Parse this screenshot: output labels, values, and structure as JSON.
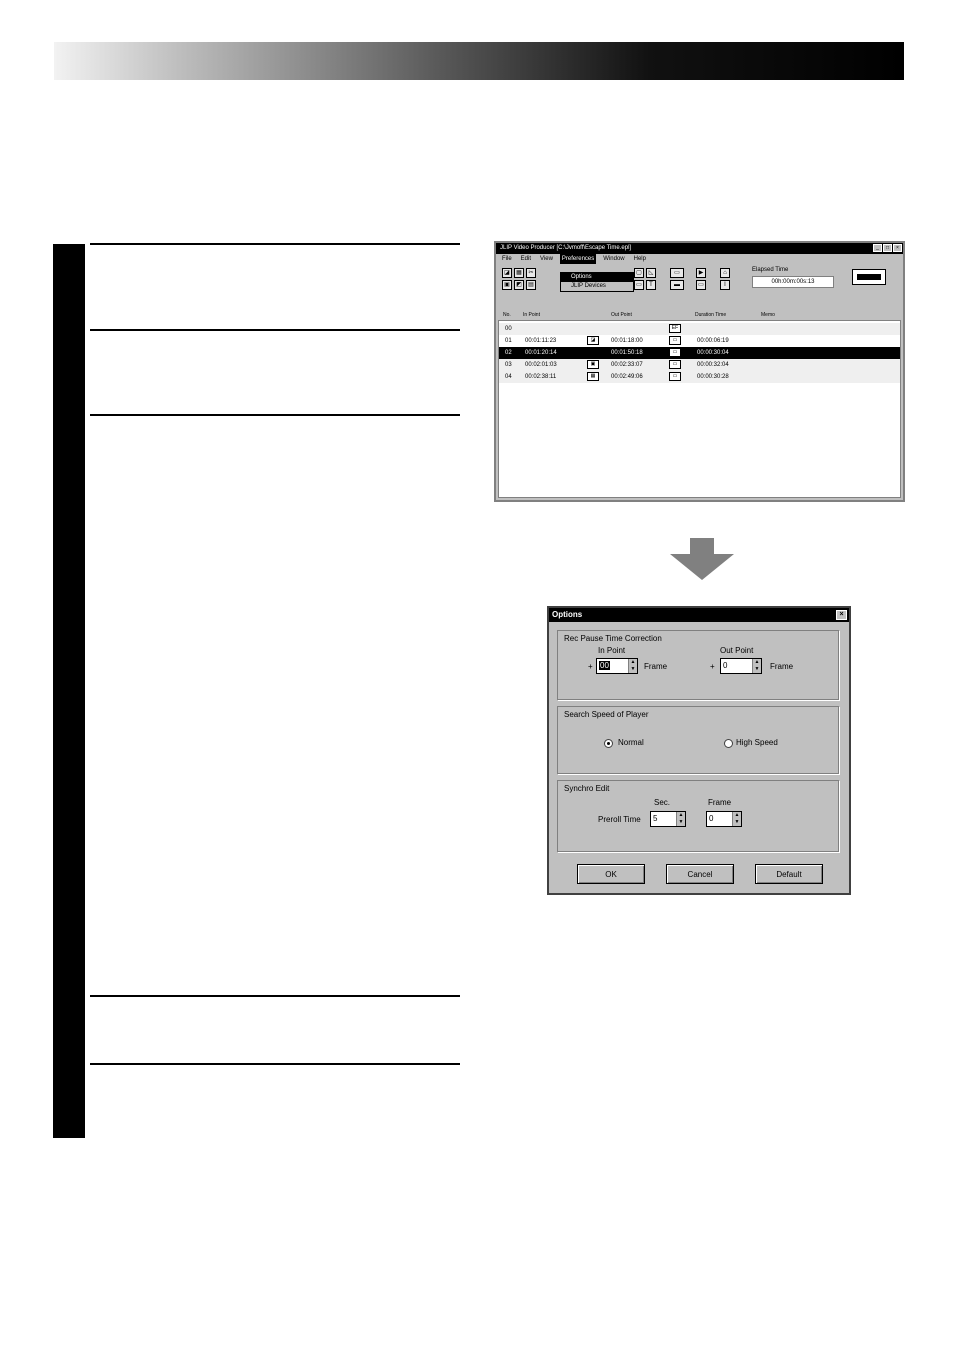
{
  "app_window": {
    "title": "JLIP Video Producer [C:\\Jvmoff\\Escape Time.epl]",
    "title_buttons": [
      "_",
      "□",
      "×"
    ],
    "menu": [
      "File",
      "Edit",
      "View",
      "Preferences",
      "Window",
      "Help"
    ],
    "active_menu_index": 3,
    "dropdown_items": [
      "Options",
      "JLIP Devices"
    ],
    "elapsed_label": "Elapsed Time",
    "elapsed_value": "00h:00m:00s:13",
    "columns": [
      "No.",
      "In Point",
      "Out Point",
      "Duration Time",
      "Memo"
    ],
    "rows": [
      {
        "no": "00",
        "in": "",
        "out": "",
        "icon_out": "EF",
        "duration": ""
      },
      {
        "no": "01",
        "in": "00:01:11:23",
        "out": "00:01:18:00",
        "icon_in": "◪",
        "icon_out": "▭",
        "duration": "00:00:06:19"
      },
      {
        "no": "02",
        "in": "00:01:20:14",
        "out": "00:01:50:18",
        "icon_in": "",
        "icon_out": "▭",
        "duration": "00:00:30:04",
        "selected": true
      },
      {
        "no": "03",
        "in": "00:02:01:03",
        "out": "00:02:33:07",
        "icon_in": "▣",
        "icon_out": "▭",
        "duration": "00:00:32:04"
      },
      {
        "no": "04",
        "in": "00:02:38:11",
        "out": "00:02:49:06",
        "icon_in": "▦",
        "icon_out": "▭",
        "duration": "00:00:30:28"
      }
    ]
  },
  "dialog": {
    "title": "Options",
    "close_glyph": "×",
    "group1_title": "Rec Pause Time Correction",
    "in_point_label": "In Point",
    "out_point_label": "Out Point",
    "sign_in": "+",
    "sign_out": "+",
    "in_value": "00",
    "out_value": "0",
    "frame_unit": "Frame",
    "group2_title": "Search Speed of Player",
    "normal_label": "Normal",
    "high_speed_label": "High Speed",
    "search_speed_selected": "Normal",
    "group3_title": "Synchro Edit",
    "sec_label": "Sec.",
    "frame_label": "Frame",
    "preroll_label": "Preroll Time",
    "sec_value": "5",
    "frame_value": "0",
    "ok_label": "OK",
    "cancel_label": "Cancel",
    "default_label": "Default"
  }
}
